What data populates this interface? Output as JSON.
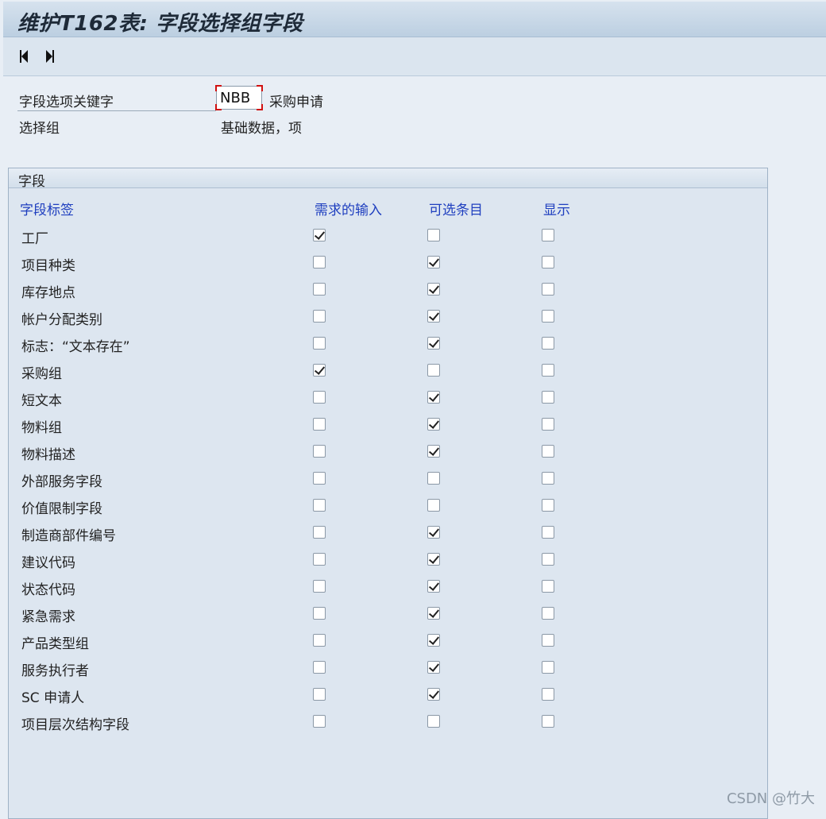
{
  "window": {
    "title": "维护T162表: 字段选择组字段"
  },
  "toolbar": {
    "back_icon": "triangle-left",
    "forward_icon": "triangle-right"
  },
  "header": {
    "key_label": "字段选项关键字",
    "key_value": "NBB",
    "key_desc": "采购申请",
    "group_label": "选择组",
    "group_value": "基础数据，项"
  },
  "panel": {
    "title": "字段",
    "columns": [
      "字段标签",
      "需求的输入",
      "可选条目",
      "显示"
    ],
    "rows": [
      {
        "label": "工厂",
        "required": true,
        "optional": false,
        "display": false
      },
      {
        "label": "项目种类",
        "required": false,
        "optional": true,
        "display": false
      },
      {
        "label": "库存地点",
        "required": false,
        "optional": true,
        "display": false
      },
      {
        "label": "帐户分配类别",
        "required": false,
        "optional": true,
        "display": false
      },
      {
        "label": "标志：“文本存在”",
        "required": false,
        "optional": true,
        "display": false
      },
      {
        "label": "采购组",
        "required": true,
        "optional": false,
        "display": false
      },
      {
        "label": "短文本",
        "required": false,
        "optional": true,
        "display": false
      },
      {
        "label": "物料组",
        "required": false,
        "optional": true,
        "display": false
      },
      {
        "label": "物料描述",
        "required": false,
        "optional": true,
        "display": false
      },
      {
        "label": "外部服务字段",
        "required": false,
        "optional": false,
        "display": false
      },
      {
        "label": "价值限制字段",
        "required": false,
        "optional": false,
        "display": false
      },
      {
        "label": "制造商部件编号",
        "required": false,
        "optional": true,
        "display": false
      },
      {
        "label": "建议代码",
        "required": false,
        "optional": true,
        "display": false
      },
      {
        "label": "状态代码",
        "required": false,
        "optional": true,
        "display": false
      },
      {
        "label": "紧急需求",
        "required": false,
        "optional": true,
        "display": false
      },
      {
        "label": "产品类型组",
        "required": false,
        "optional": true,
        "display": false
      },
      {
        "label": "服务执行者",
        "required": false,
        "optional": true,
        "display": false
      },
      {
        "label": "SC 申请人",
        "required": false,
        "optional": true,
        "display": false
      },
      {
        "label": "项目层次结构字段",
        "required": false,
        "optional": false,
        "display": false
      }
    ]
  },
  "watermark": "CSDN @竹大",
  "colors": {
    "header_text": "#1f3fbf",
    "panel_bg": "#dde6f0",
    "focus_border": "#d01010"
  }
}
